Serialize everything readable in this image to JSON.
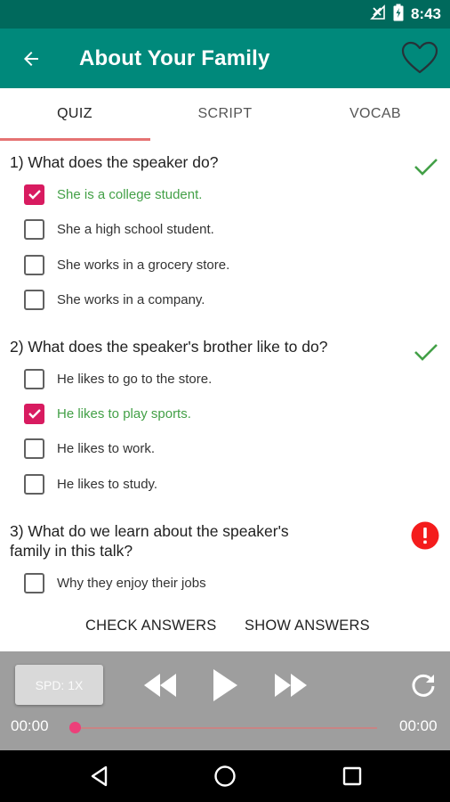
{
  "status_bar": {
    "time": "8:43",
    "icons": [
      "signal-off-icon",
      "battery-charging-icon"
    ]
  },
  "app_bar": {
    "title": "About Your Family",
    "back_icon": "arrow-back-icon",
    "favorite_icon": "heart-outline-icon"
  },
  "tabs": [
    {
      "label": "QUIZ",
      "active": true
    },
    {
      "label": "SCRIPT",
      "active": false
    },
    {
      "label": "VOCAB",
      "active": false
    }
  ],
  "quiz": {
    "questions": [
      {
        "text": "1) What does the speaker do?",
        "status": "correct",
        "options": [
          {
            "label": "She is a college student.",
            "checked": true
          },
          {
            "label": "She a high school student.",
            "checked": false
          },
          {
            "label": "She works in a grocery store.",
            "checked": false
          },
          {
            "label": "She works in a company.",
            "checked": false
          }
        ]
      },
      {
        "text": "2) What does the speaker's brother like to do?",
        "status": "correct",
        "options": [
          {
            "label": "He likes to go to the store.",
            "checked": false
          },
          {
            "label": "He likes to play sports.",
            "checked": true
          },
          {
            "label": "He likes to work.",
            "checked": false
          },
          {
            "label": "He likes to study.",
            "checked": false
          }
        ]
      },
      {
        "text_line1": "3) What do we learn about the speaker's",
        "text_line2": "family in this talk?",
        "status": "unanswered",
        "options": [
          {
            "label": "Why they enjoy their jobs",
            "checked": false
          }
        ]
      }
    ],
    "check_answers_label": "CHECK ANSWERS",
    "show_answers_label": "SHOW ANSWERS"
  },
  "player": {
    "speed_label": "SPD: 1X",
    "current_time": "00:00",
    "total_time": "00:00",
    "progress": 0
  },
  "colors": {
    "primary": "#00897b",
    "primary_dark": "#00695c",
    "accent": "#d81b60",
    "correct": "#43a047",
    "error": "#f41c1c"
  }
}
